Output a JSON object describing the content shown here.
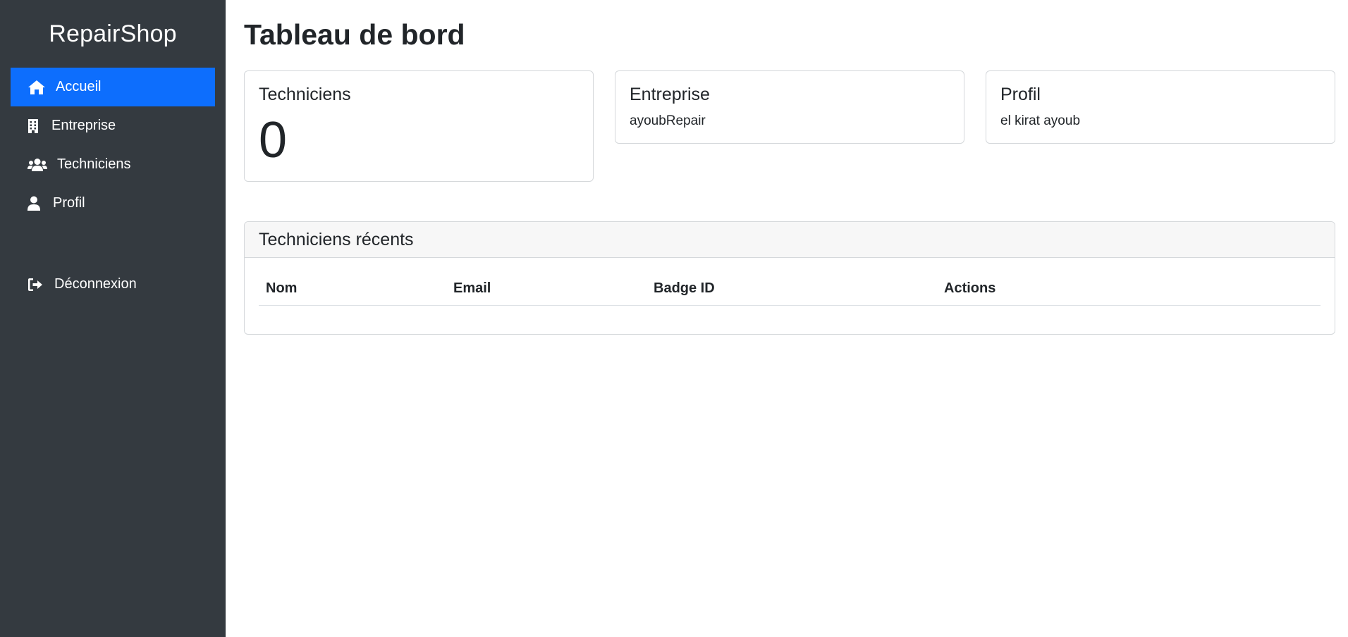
{
  "sidebar": {
    "brand": "RepairShop",
    "items": [
      {
        "label": "Accueil",
        "icon": "home-icon",
        "active": true
      },
      {
        "label": "Entreprise",
        "icon": "building-icon",
        "active": false
      },
      {
        "label": "Techniciens",
        "icon": "users-icon",
        "active": false
      },
      {
        "label": "Profil",
        "icon": "user-icon",
        "active": false
      }
    ],
    "logout": {
      "label": "Déconnexion",
      "icon": "sign-out-icon"
    }
  },
  "main": {
    "title": "Tableau de bord",
    "cards": {
      "technicians": {
        "title": "Techniciens",
        "count": "0"
      },
      "company": {
        "title": "Entreprise",
        "value": "ayoubRepair"
      },
      "profile": {
        "title": "Profil",
        "value": "el kirat ayoub"
      }
    },
    "recent": {
      "title": "Techniciens récents",
      "columns": [
        "Nom",
        "Email",
        "Badge ID",
        "Actions"
      ],
      "rows": []
    }
  },
  "colors": {
    "sidebar_bg": "#343a40",
    "active_bg": "#0d6efd"
  }
}
